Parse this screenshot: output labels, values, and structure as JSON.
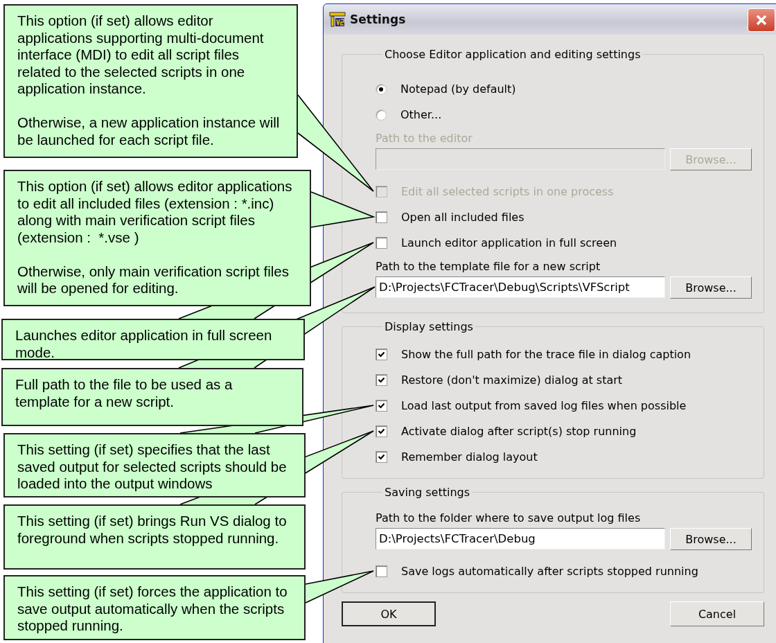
{
  "callouts": [
    {
      "paragraphs": [
        "This option (if set) allows editor applications supporting multi-document interface (MDI) to edit all script files related to the selected scripts in one application instance.",
        "Otherwise, a new application instance will be launched for each script file."
      ]
    },
    {
      "paragraphs": [
        "This option (if set) allows editor applications to edit all included files (extension : *.inc) along with main verification script files (extension :  *.vse )",
        "Otherwise, only main verification script files will be opened for editing."
      ]
    },
    {
      "paragraphs": [
        "Launches editor application in full screen mode."
      ]
    },
    {
      "paragraphs": [
        "Full path to the file to be used as a template for a new script."
      ]
    },
    {
      "paragraphs": [
        "This setting (if set) specifies that the last saved output for selected scripts should be loaded into the output windows"
      ]
    },
    {
      "paragraphs": [
        "This setting (if set) brings Run VS dialog to foreground when scripts stopped running."
      ]
    },
    {
      "paragraphs": [
        "This setting (if set) forces the application to save output automatically when the scripts stopped running."
      ]
    }
  ],
  "window": {
    "title": "Settings"
  },
  "groups": [
    {
      "title": "Choose Editor application and editing settings",
      "items": [
        {
          "kind": "radio",
          "label": "Notepad (by default)",
          "selected": true
        },
        {
          "kind": "radio",
          "label": "Other...",
          "selected": false
        },
        {
          "kind": "path",
          "label": "Path to the editor",
          "button": "Browse...",
          "disabled": true
        },
        {
          "kind": "check",
          "label": "Edit all selected scripts in one process",
          "checked": false,
          "disabled": true
        },
        {
          "kind": "check",
          "label": "Open all included files",
          "checked": false,
          "disabled": false
        },
        {
          "kind": "check",
          "label": "Launch editor application in full screen",
          "checked": false,
          "disabled": false
        },
        {
          "kind": "path",
          "label": "Path to the template file for a new script",
          "value": "D:\\Projects\\FCTracer\\Debug\\Scripts\\VFScript",
          "button": "Browse...",
          "disabled": false
        }
      ]
    },
    {
      "title": "Display settings",
      "items": [
        {
          "kind": "check",
          "label": "Show the full path for the trace file in dialog caption",
          "checked": true,
          "disabled": false
        },
        {
          "kind": "check",
          "label": "Restore (don't maximize) dialog at start",
          "checked": true,
          "disabled": false
        },
        {
          "kind": "check",
          "label": "Load last output from saved log files when possible",
          "checked": true,
          "disabled": false
        },
        {
          "kind": "check",
          "label": "Activate dialog after script(s) stop running",
          "checked": true,
          "disabled": false
        },
        {
          "kind": "check",
          "label": "Remember dialog layout",
          "checked": true,
          "disabled": false
        }
      ]
    },
    {
      "title": "Saving settings",
      "items": [
        {
          "kind": "path",
          "label": "Path to the folder where to save output log files",
          "value": "D:\\Projects\\FCTracer\\Debug",
          "button": "Browse...",
          "disabled": false
        },
        {
          "kind": "check",
          "label": "Save logs automatically after scripts stopped running",
          "checked": false,
          "disabled": false
        }
      ]
    }
  ],
  "buttons": [
    {
      "label": "OK",
      "default": true
    },
    {
      "label": "Cancel",
      "default": false
    }
  ]
}
